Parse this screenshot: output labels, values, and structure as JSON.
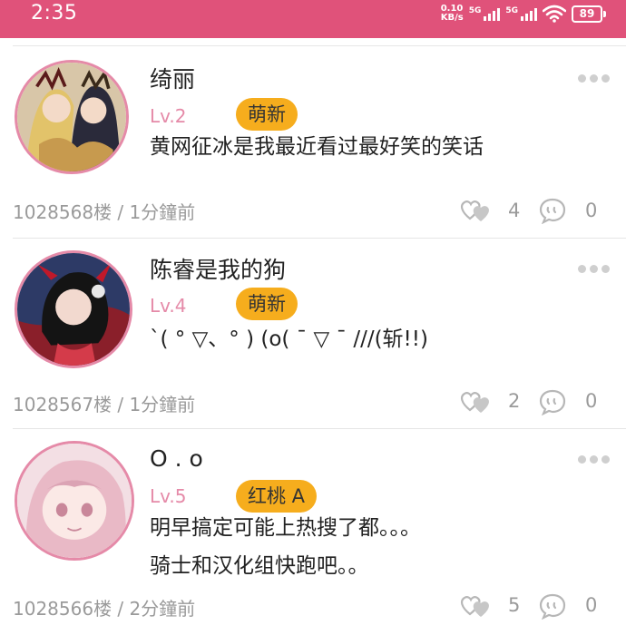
{
  "status_bar": {
    "time": "2:35",
    "net_speed_value": "0.10",
    "net_speed_unit": "KB/s",
    "sim1": "5G",
    "sim2": "5G",
    "battery": "89"
  },
  "posts": [
    {
      "username": "绮丽",
      "level": "Lv.2",
      "badge": "萌新",
      "content": "黄网征冰是我最近看过最好笑的笑话",
      "meta": "1028568楼 / 1分鐘前",
      "likes": "4",
      "comments": "0"
    },
    {
      "username": "陈睿是我的狗",
      "level": "Lv.4",
      "badge": "萌新",
      "content": "`( ° ▽、° ) (o( ˉ ▽ ˉ ///(斩!!)",
      "meta": "1028567楼 / 1分鐘前",
      "likes": "2",
      "comments": "0"
    },
    {
      "username": "O . o",
      "level": "Lv.5",
      "badge": "红桃 A",
      "content": "明早搞定可能上热搜了都。。。\n骑士和汉化组快跑吧。。",
      "meta": "1028566楼 / 2分鐘前",
      "likes": "5",
      "comments": "0"
    }
  ],
  "colors": {
    "status_bar": "#e0527a",
    "level": "#e58aa8",
    "badge": "#f6ad1d"
  },
  "icons": {
    "more": "more-dots-icon",
    "like": "like-hearts-icon",
    "comment": "comment-bubble-icon"
  }
}
